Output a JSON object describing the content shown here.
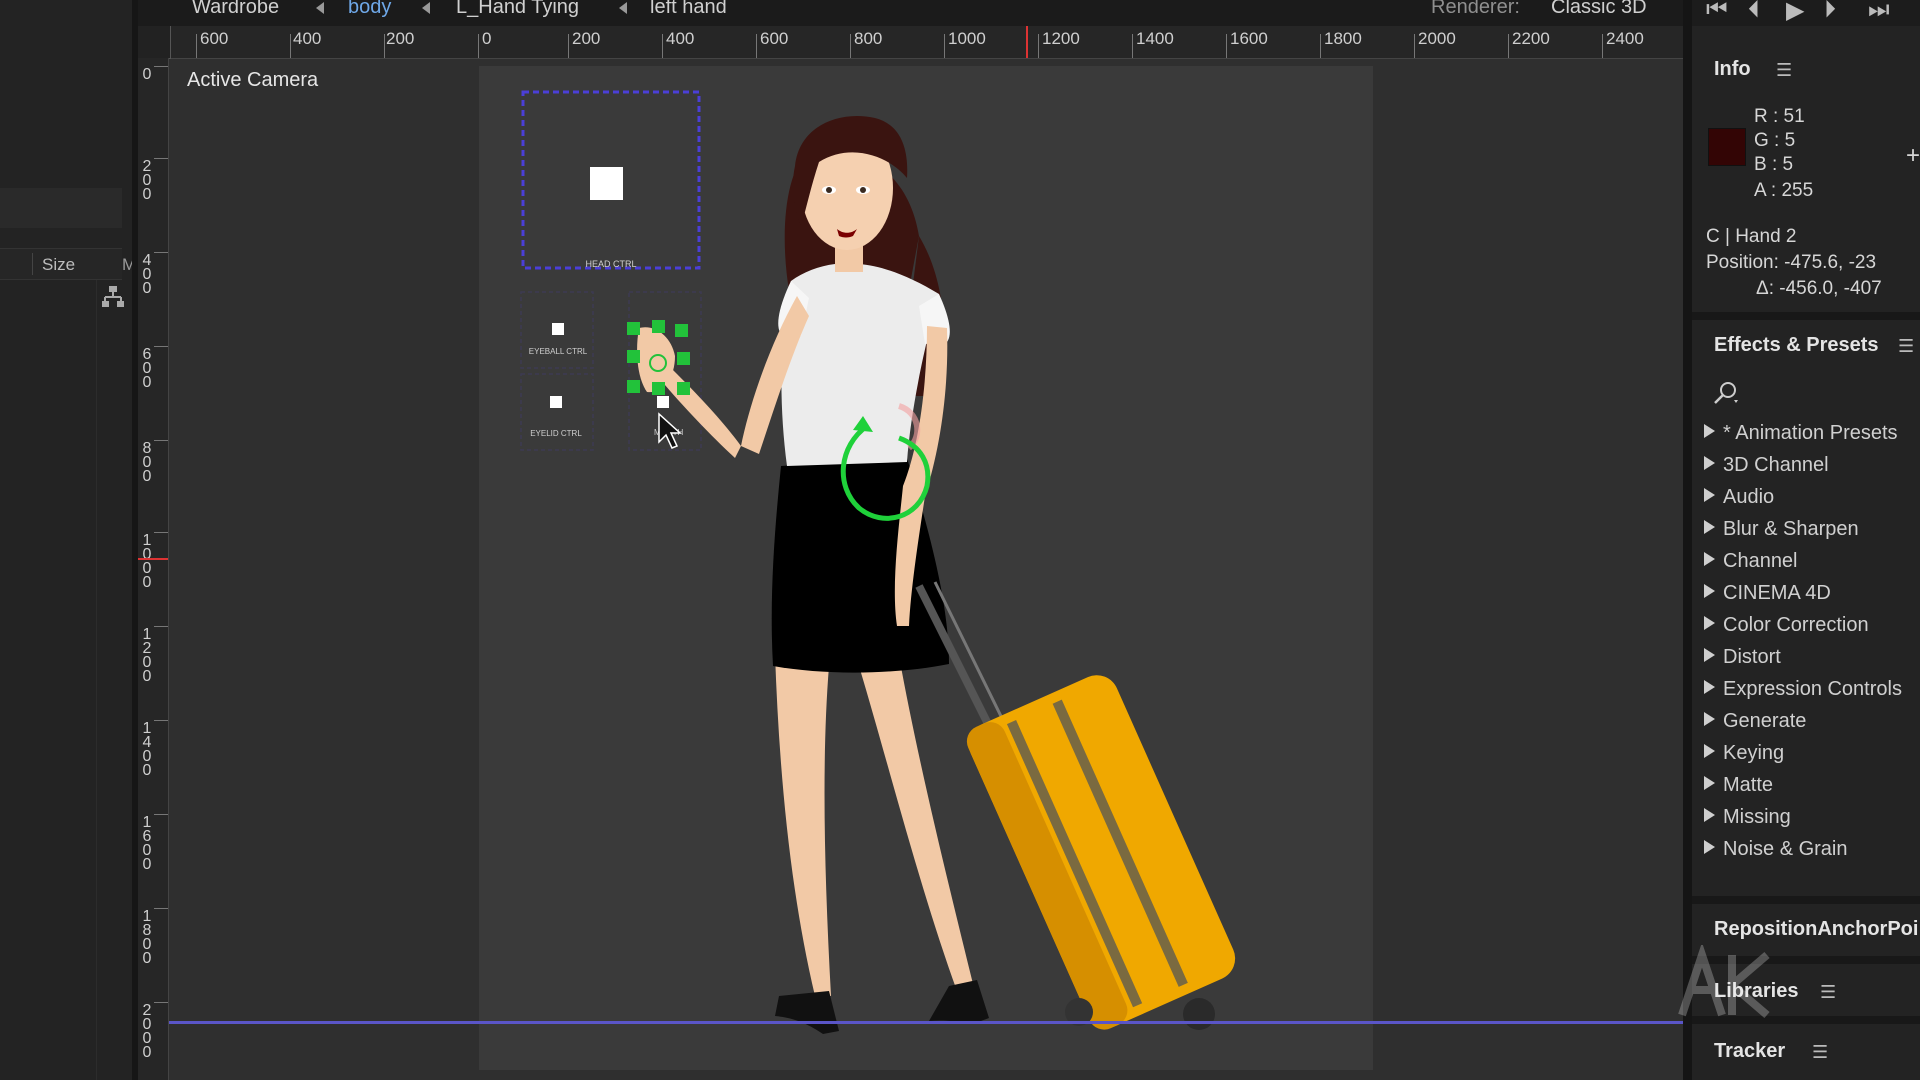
{
  "breadcrumbs": {
    "items": [
      "Wardrobe",
      "body",
      "L_Hand Tying",
      "left hand"
    ],
    "active_index": 1
  },
  "renderer": {
    "label": "Renderer:",
    "value": "Classic 3D"
  },
  "left_panel": {
    "size_header": "Size",
    "next_header": "M"
  },
  "ruler": {
    "horizontal": [
      "600",
      "400",
      "200",
      "0",
      "200",
      "400",
      "600",
      "800",
      "1000",
      "1200",
      "1400",
      "1600",
      "1800",
      "2000",
      "2200",
      "2400"
    ],
    "vertical": [
      "0",
      "200",
      "400",
      "600",
      "800",
      "1000",
      "1200",
      "1400",
      "1600",
      "1800",
      "2000"
    ]
  },
  "viewer": {
    "label": "Active Camera",
    "controls": {
      "head": "HEAD CTRL",
      "eyeball": "EYEBALL CTRL",
      "eyelid": "EYELID CTRL",
      "brow": "E",
      "mouth": "MOUTH"
    }
  },
  "info": {
    "title": "Info",
    "r": "R : 51",
    "g": "G : 5",
    "b": "B : 5",
    "a": "A : 255",
    "swatch_color": "#330505",
    "layer": "C | Hand 2",
    "position": "Position: -475.6, -23",
    "delta": "Δ: -456.0, -407"
  },
  "effects": {
    "title": "Effects & Presets",
    "items": [
      "* Animation Presets",
      "3D Channel",
      "Audio",
      "Blur & Sharpen",
      "Channel",
      "CINEMA 4D",
      "Color Correction",
      "Distort",
      "Expression Controls",
      "Generate",
      "Keying",
      "Matte",
      "Missing",
      "Noise & Grain"
    ]
  },
  "panels": {
    "reposition": "RepositionAnchorPoi",
    "libraries": "Libraries",
    "tracker": "Tracker"
  },
  "colors": {
    "active_crumb": "#6fa8e8",
    "selection_green": "#22c23a",
    "control_dash": "#4b3fd6",
    "suitcase": "#f0a800",
    "horizon": "#5a55c8"
  }
}
